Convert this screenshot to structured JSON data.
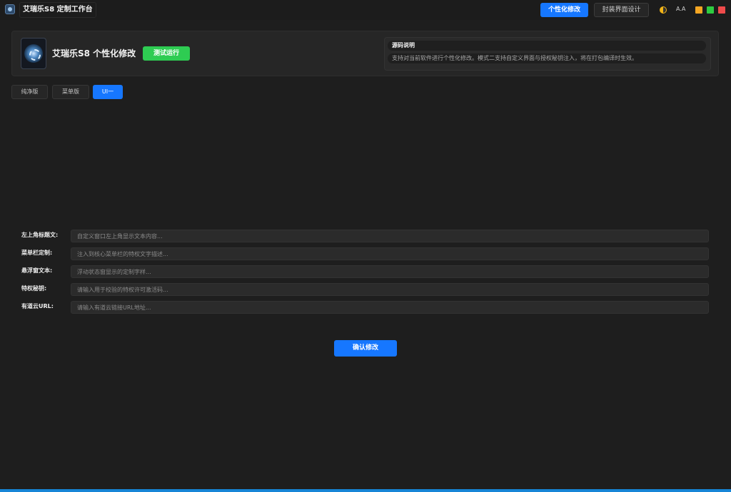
{
  "app": {
    "title": "艾瑞乐S8 定制工作台"
  },
  "top_tabs": [
    {
      "label": "个性化修改",
      "active": true
    },
    {
      "label": "封装界面设计",
      "active": false
    }
  ],
  "window_controls": {
    "theme_icon": "half-circle-icon",
    "font_icon": "font-size-icon",
    "font_icon_text": "A.A",
    "minimize_color": "#f5a623",
    "maximize_color": "#2ecc40",
    "close_color": "#ef4b4b"
  },
  "header": {
    "title": "艾瑞乐S8 个性化修改",
    "test_run_label": "测试运行",
    "description_title": "源码说明",
    "description_text": "支持对当前软件进行个性化修改。模式二支持自定义界面与授权秘钥注入，将在打包编译时生效。"
  },
  "sub_tabs": [
    {
      "label": "纯净版",
      "active": false
    },
    {
      "label": "菜单版",
      "active": false
    },
    {
      "label": "UI一",
      "active": true
    }
  ],
  "form": {
    "fields": [
      {
        "label": "左上角标题文:",
        "value": "",
        "placeholder": "自定义窗口左上角显示文本内容..."
      },
      {
        "label": "菜单栏定制:",
        "value": "",
        "placeholder": "注入到核心菜单栏的特权文字描述..."
      },
      {
        "label": "悬浮窗文本:",
        "value": "",
        "placeholder": "浮动状态窗显示的定制字样..."
      },
      {
        "label": "特权秘钥:",
        "value": "",
        "placeholder": "请输入用于校验的特权许可激活码..."
      },
      {
        "label": "有道云URL:",
        "value": "",
        "placeholder": "请输入有道云链接URL地址..."
      }
    ],
    "confirm_label": "确认修改"
  },
  "colors": {
    "accent": "#1677ff",
    "success": "#2ecc52",
    "background": "#1e1e1e",
    "panel": "#262626",
    "bottom_strip": "#1685d6"
  }
}
